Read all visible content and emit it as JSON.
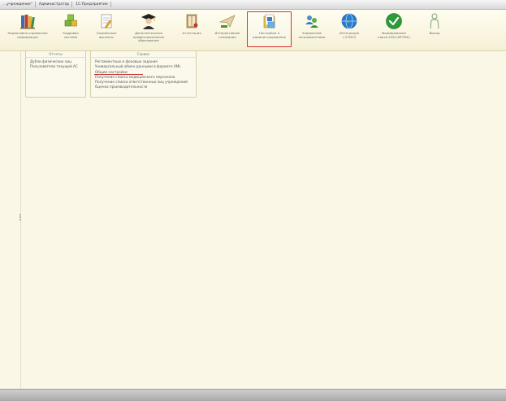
{
  "window": {
    "title_segments": [
      "...учреждение\"",
      "Администратор",
      "1С:Предприятие"
    ]
  },
  "toolbar": {
    "items": [
      {
        "name": "ref-info-button",
        "icon": "books-icon",
        "label": "Нормативно-справочная\nинформация"
      },
      {
        "name": "hr-button",
        "icon": "box-stack-icon",
        "label": "Кадровая\nсистема"
      },
      {
        "name": "social-payments-button",
        "icon": "document-pencil-icon",
        "label": "Социальные\nвыплаты"
      },
      {
        "name": "additional-education-button",
        "icon": "graduate-icon",
        "label": "Дополнительное\nпрофессиональное\nобразование"
      },
      {
        "name": "attestation-button",
        "icon": "book-open-icon",
        "label": "Аттестация"
      },
      {
        "name": "generator-button",
        "icon": "plane-icon",
        "label": "Интерактивное\nгенерация"
      },
      {
        "name": "settings-admin-button",
        "icon": "settings-folder-icon",
        "label": "Настройки и\nадминистрирование",
        "active": true
      },
      {
        "name": "users-button",
        "icon": "users-icon",
        "label": "Управление\nпользователями"
      },
      {
        "name": "integration-button",
        "icon": "globe-icon",
        "label": "Интеграция\nс ЕГИСЗ"
      },
      {
        "name": "form-button",
        "icon": "check-icon",
        "label": "Формирование\nкарты НСИ (МГРНК)"
      },
      {
        "name": "exit-button",
        "icon": "person-outline-icon",
        "label": "Выход"
      }
    ]
  },
  "panels": {
    "reports": {
      "title": "Отчеты",
      "items": [
        "Дубли физических лиц",
        "Пользователи текущей АС"
      ]
    },
    "service": {
      "title": "Сервис",
      "items": [
        "Регламентные и фоновые задания",
        "Универсальный обмен данными в формате XML",
        "Общие настройки",
        "Получение списка медицинского персонала",
        "Получение списка ответственных лиц учреждений",
        "Оценка производительности"
      ],
      "highlighted_index": 2
    }
  },
  "colors": {
    "background": "#faf7e6",
    "highlight": "#d83030"
  }
}
